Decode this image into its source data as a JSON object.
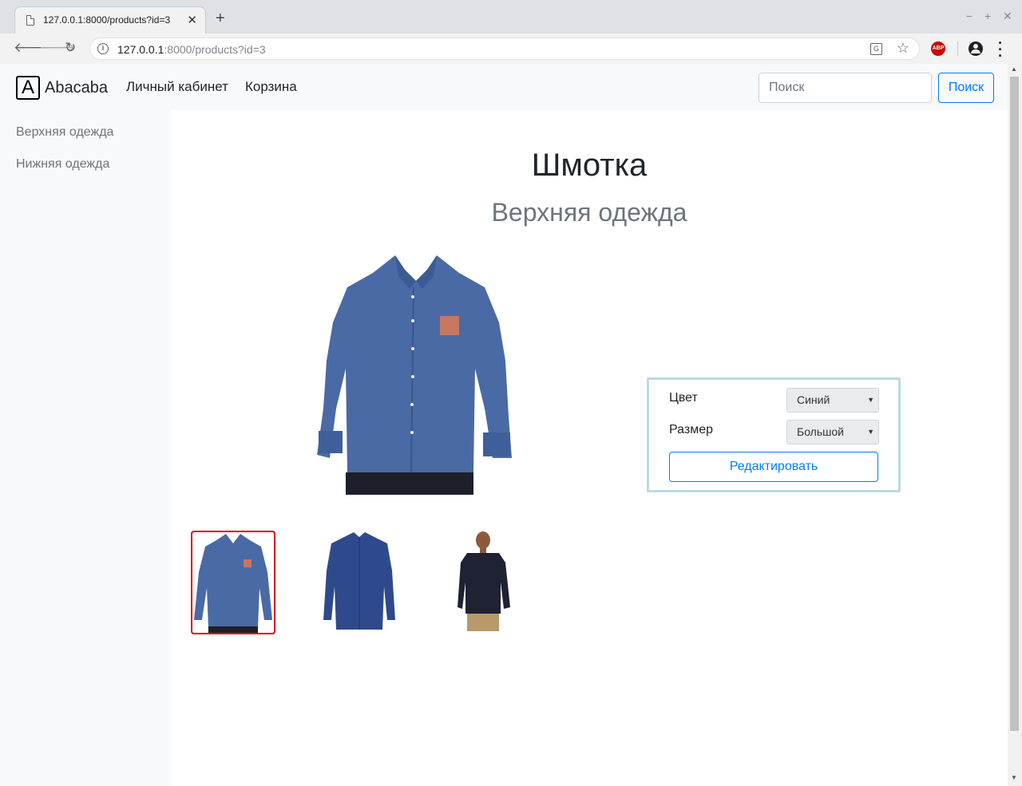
{
  "browser": {
    "tab_title": "127.0.0.1:8000/products?id=3",
    "tab_close": "✕",
    "new_tab": "+",
    "url_host": "127.0.0.1",
    "url_rest": ":8000/products?id=3",
    "abp_label": "ABP",
    "window_controls": [
      "−",
      "+",
      "✕"
    ]
  },
  "navbar": {
    "logo_letter": "A",
    "brand": "Abacaba",
    "links": [
      "Личный кабинет",
      "Корзина"
    ],
    "search_placeholder": "Поиск",
    "search_button": "Поиск"
  },
  "sidebar": {
    "items": [
      "Верхняя одежда",
      "Нижняя одежда"
    ]
  },
  "product": {
    "title": "Шмотка",
    "category": "Верхняя одежда",
    "options": {
      "color_label": "Цвет",
      "color_value": "Синий",
      "size_label": "Размер",
      "size_value": "Большой",
      "edit_button": "Редактировать"
    },
    "thumbnails": [
      {
        "name": "blue-shirt-pocket",
        "selected": true
      },
      {
        "name": "navy-shirt",
        "selected": false
      },
      {
        "name": "man-in-dark-shirt",
        "selected": false
      }
    ]
  },
  "colors": {
    "primary": "#007bff",
    "shirt_blue": "#4a6aa5",
    "selected_border": "#dc0000"
  }
}
